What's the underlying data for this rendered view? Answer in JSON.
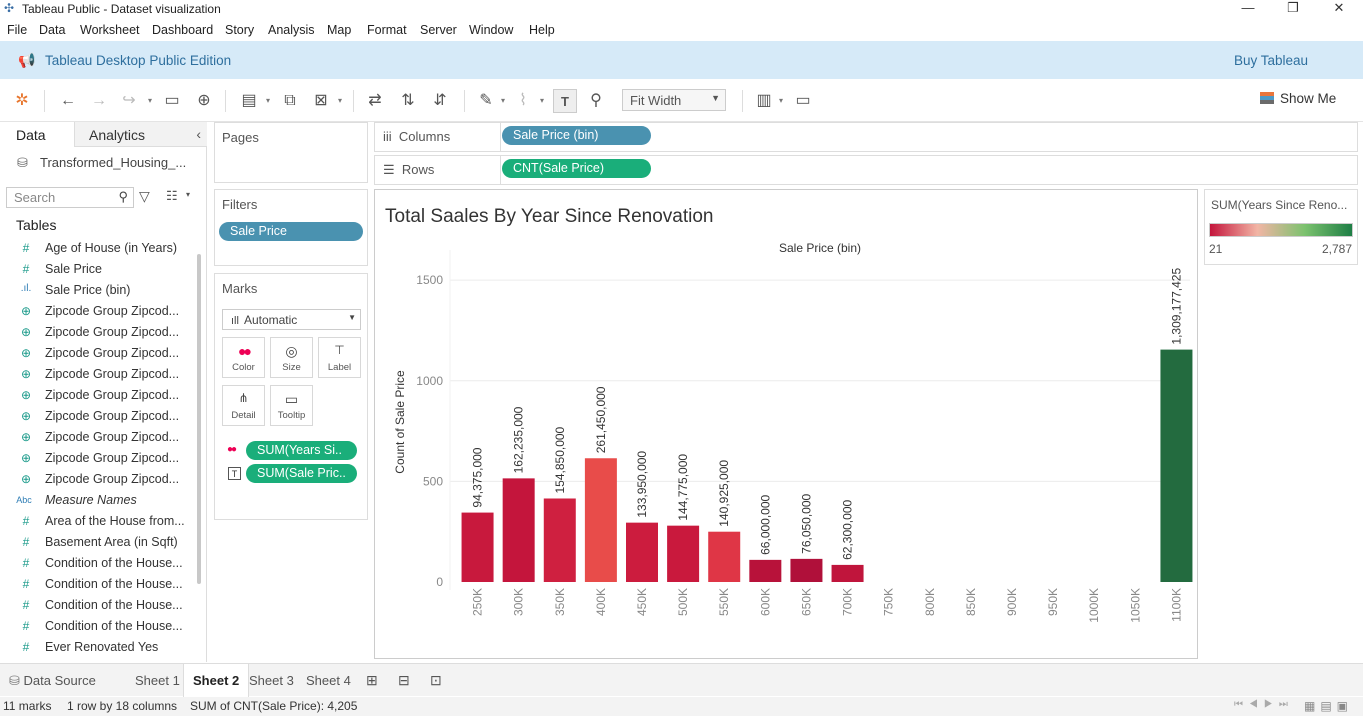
{
  "window": {
    "title": "Tableau Public - Dataset visualization",
    "minimize": "—",
    "maximize": "❐",
    "close": "✕"
  },
  "menu": [
    "File",
    "Data",
    "Worksheet",
    "Dashboard",
    "Story",
    "Analysis",
    "Map",
    "Format",
    "Server",
    "Window",
    "Help"
  ],
  "banner": {
    "edition": "Tableau Desktop Public Edition",
    "buy": "Buy Tableau"
  },
  "toolbar": {
    "fit": "Fit Width",
    "show_me": "Show Me"
  },
  "data_pane": {
    "tab_data": "Data",
    "tab_analytics": "Analytics",
    "datasource": "Transformed_Housing_...",
    "search_placeholder": "Search",
    "tables_heading": "Tables",
    "fields": [
      {
        "icon": "#",
        "label": "Age of House (in Years)"
      },
      {
        "icon": "#",
        "label": "Sale Price"
      },
      {
        "icon": "bin",
        "label": "Sale Price (bin)"
      },
      {
        "icon": "globe",
        "label": "Zipcode Group Zipcod..."
      },
      {
        "icon": "globe",
        "label": "Zipcode Group Zipcod..."
      },
      {
        "icon": "globe",
        "label": "Zipcode Group Zipcod..."
      },
      {
        "icon": "globe",
        "label": "Zipcode Group Zipcod..."
      },
      {
        "icon": "globe",
        "label": "Zipcode Group Zipcod..."
      },
      {
        "icon": "globe",
        "label": "Zipcode Group Zipcod..."
      },
      {
        "icon": "globe",
        "label": "Zipcode Group Zipcod..."
      },
      {
        "icon": "globe",
        "label": "Zipcode Group Zipcod..."
      },
      {
        "icon": "globe",
        "label": "Zipcode Group Zipcod..."
      },
      {
        "icon": "Abc",
        "label": "Measure Names"
      },
      {
        "icon": "#",
        "label": "Area of the House from..."
      },
      {
        "icon": "#",
        "label": "Basement Area (in Sqft)"
      },
      {
        "icon": "#",
        "label": "Condition of the House..."
      },
      {
        "icon": "#",
        "label": "Condition of the House..."
      },
      {
        "icon": "#",
        "label": "Condition of the House..."
      },
      {
        "icon": "#",
        "label": "Condition of the House..."
      },
      {
        "icon": "#",
        "label": "Ever Renovated Yes"
      }
    ]
  },
  "cards": {
    "pages": "Pages",
    "filters": "Filters",
    "filter_pill": "Sale Price",
    "marks": "Marks",
    "mark_type": "Automatic",
    "mark_buttons": [
      "Color",
      "Size",
      "Label",
      "Detail",
      "Tooltip"
    ],
    "mark_pills": [
      "SUM(Years Si..",
      "SUM(Sale Pric.."
    ]
  },
  "shelves": {
    "columns_label": "Columns",
    "columns_pill": "Sale Price (bin)",
    "rows_label": "Rows",
    "rows_pill": "CNT(Sale Price)"
  },
  "legend": {
    "title": "SUM(Years Since Reno...",
    "min": "21",
    "max": "2,787",
    "colors": [
      "#c4153c",
      "#f2b5a5",
      "#7cc26e",
      "#1e7e45"
    ]
  },
  "sheets": {
    "data_source": "Data Source",
    "tabs": [
      "Sheet 1",
      "Sheet 2",
      "Sheet 3",
      "Sheet 4"
    ],
    "active": 1
  },
  "status": {
    "marks": "11 marks",
    "dims": "1 row by 18 columns",
    "sum": "SUM of CNT(Sale Price): 4,205"
  },
  "chart_data": {
    "type": "bar",
    "title": "Total Saales By Year Since Renovation",
    "xlabel": "Sale Price (bin)",
    "ylabel": "Count of Sale Price",
    "ylim": [
      0,
      1650
    ],
    "yticks": [
      0,
      500,
      1000,
      1500
    ],
    "categories": [
      "250K",
      "300K",
      "350K",
      "400K",
      "450K",
      "500K",
      "550K",
      "600K",
      "650K",
      "700K",
      "750K",
      "800K",
      "850K",
      "900K",
      "950K",
      "1000K",
      "1050K",
      "1100K"
    ],
    "values": [
      345,
      515,
      415,
      615,
      295,
      280,
      250,
      110,
      115,
      85,
      0,
      0,
      0,
      0,
      0,
      0,
      0,
      1155
    ],
    "labels": [
      "94,375,000",
      "162,235,000",
      "154,850,000",
      "261,450,000",
      "133,950,000",
      "144,775,000",
      "140,925,000",
      "66,000,000",
      "76,050,000",
      "62,300,000",
      "",
      "",
      "",
      "",
      "",
      "",
      "",
      "1,309,177,425"
    ],
    "colors": [
      "#c8193d",
      "#c4153c",
      "#cf2040",
      "#e84c4a",
      "#cc1c3e",
      "#c9193d",
      "#df3646",
      "#b8123a",
      "#b0103a",
      "#c0153c",
      "",
      "",
      "",
      "",
      "",
      "",
      "",
      "#236b3f"
    ],
    "grid": true
  }
}
